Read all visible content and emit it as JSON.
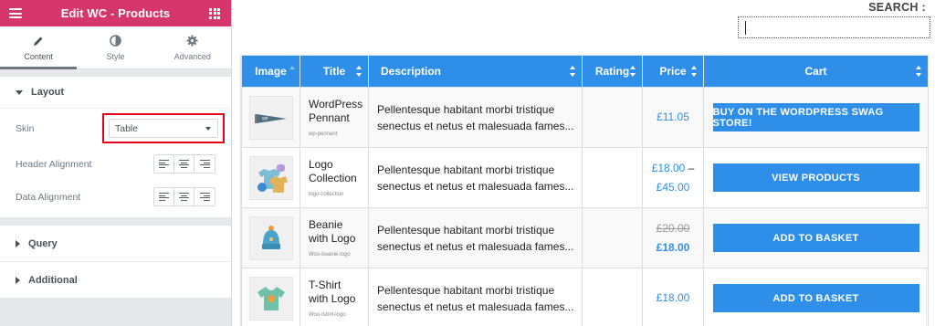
{
  "sidebar": {
    "title": "Edit WC - Products",
    "tabs": [
      {
        "label": "Content"
      },
      {
        "label": "Style"
      },
      {
        "label": "Advanced"
      }
    ],
    "layout": {
      "heading": "Layout",
      "skin_label": "Skin",
      "skin_value": "Table",
      "header_alignment_label": "Header Alignment",
      "data_alignment_label": "Data Alignment"
    },
    "query_heading": "Query",
    "additional_heading": "Additional"
  },
  "main": {
    "search_label": "SEARCH :",
    "columns": [
      "Image",
      "Title",
      "Description",
      "Rating",
      "Price",
      "Cart"
    ],
    "rows": [
      {
        "title": "WordPress Pennant",
        "slug": "wp-pennant",
        "description": "Pellentesque habitant morbi tristique senectus et netus et malesuada fames...",
        "price": "£11.05",
        "price_to": "",
        "old_price": "",
        "cart": "BUY ON THE WORDPRESS SWAG STORE!"
      },
      {
        "title": "Logo Collection",
        "slug": "logo-collection",
        "description": "Pellentesque habitant morbi tristique senectus et netus et malesuada fames...",
        "price": "£18.00",
        "price_to": "£45.00",
        "old_price": "",
        "cart": "VIEW PRODUCTS"
      },
      {
        "title": "Beanie with Logo",
        "slug": "Woo-beanie-logo",
        "description": "Pellentesque habitant morbi tristique senectus et netus et malesuada fames...",
        "price": "£18.00",
        "price_to": "",
        "old_price": "£20.00",
        "cart": "ADD TO BASKET"
      },
      {
        "title": "T-Shirt with Logo",
        "slug": "Woo-tshirt-logo",
        "description": "Pellentesque habitant morbi tristique senectus et netus et malesuada fames...",
        "price": "£18.00",
        "price_to": "",
        "old_price": "",
        "cart": "ADD TO BASKET"
      }
    ]
  },
  "colors": {
    "brand": "#d5366b",
    "table_header": "#2f8fe8",
    "highlight": "#e3001b"
  }
}
